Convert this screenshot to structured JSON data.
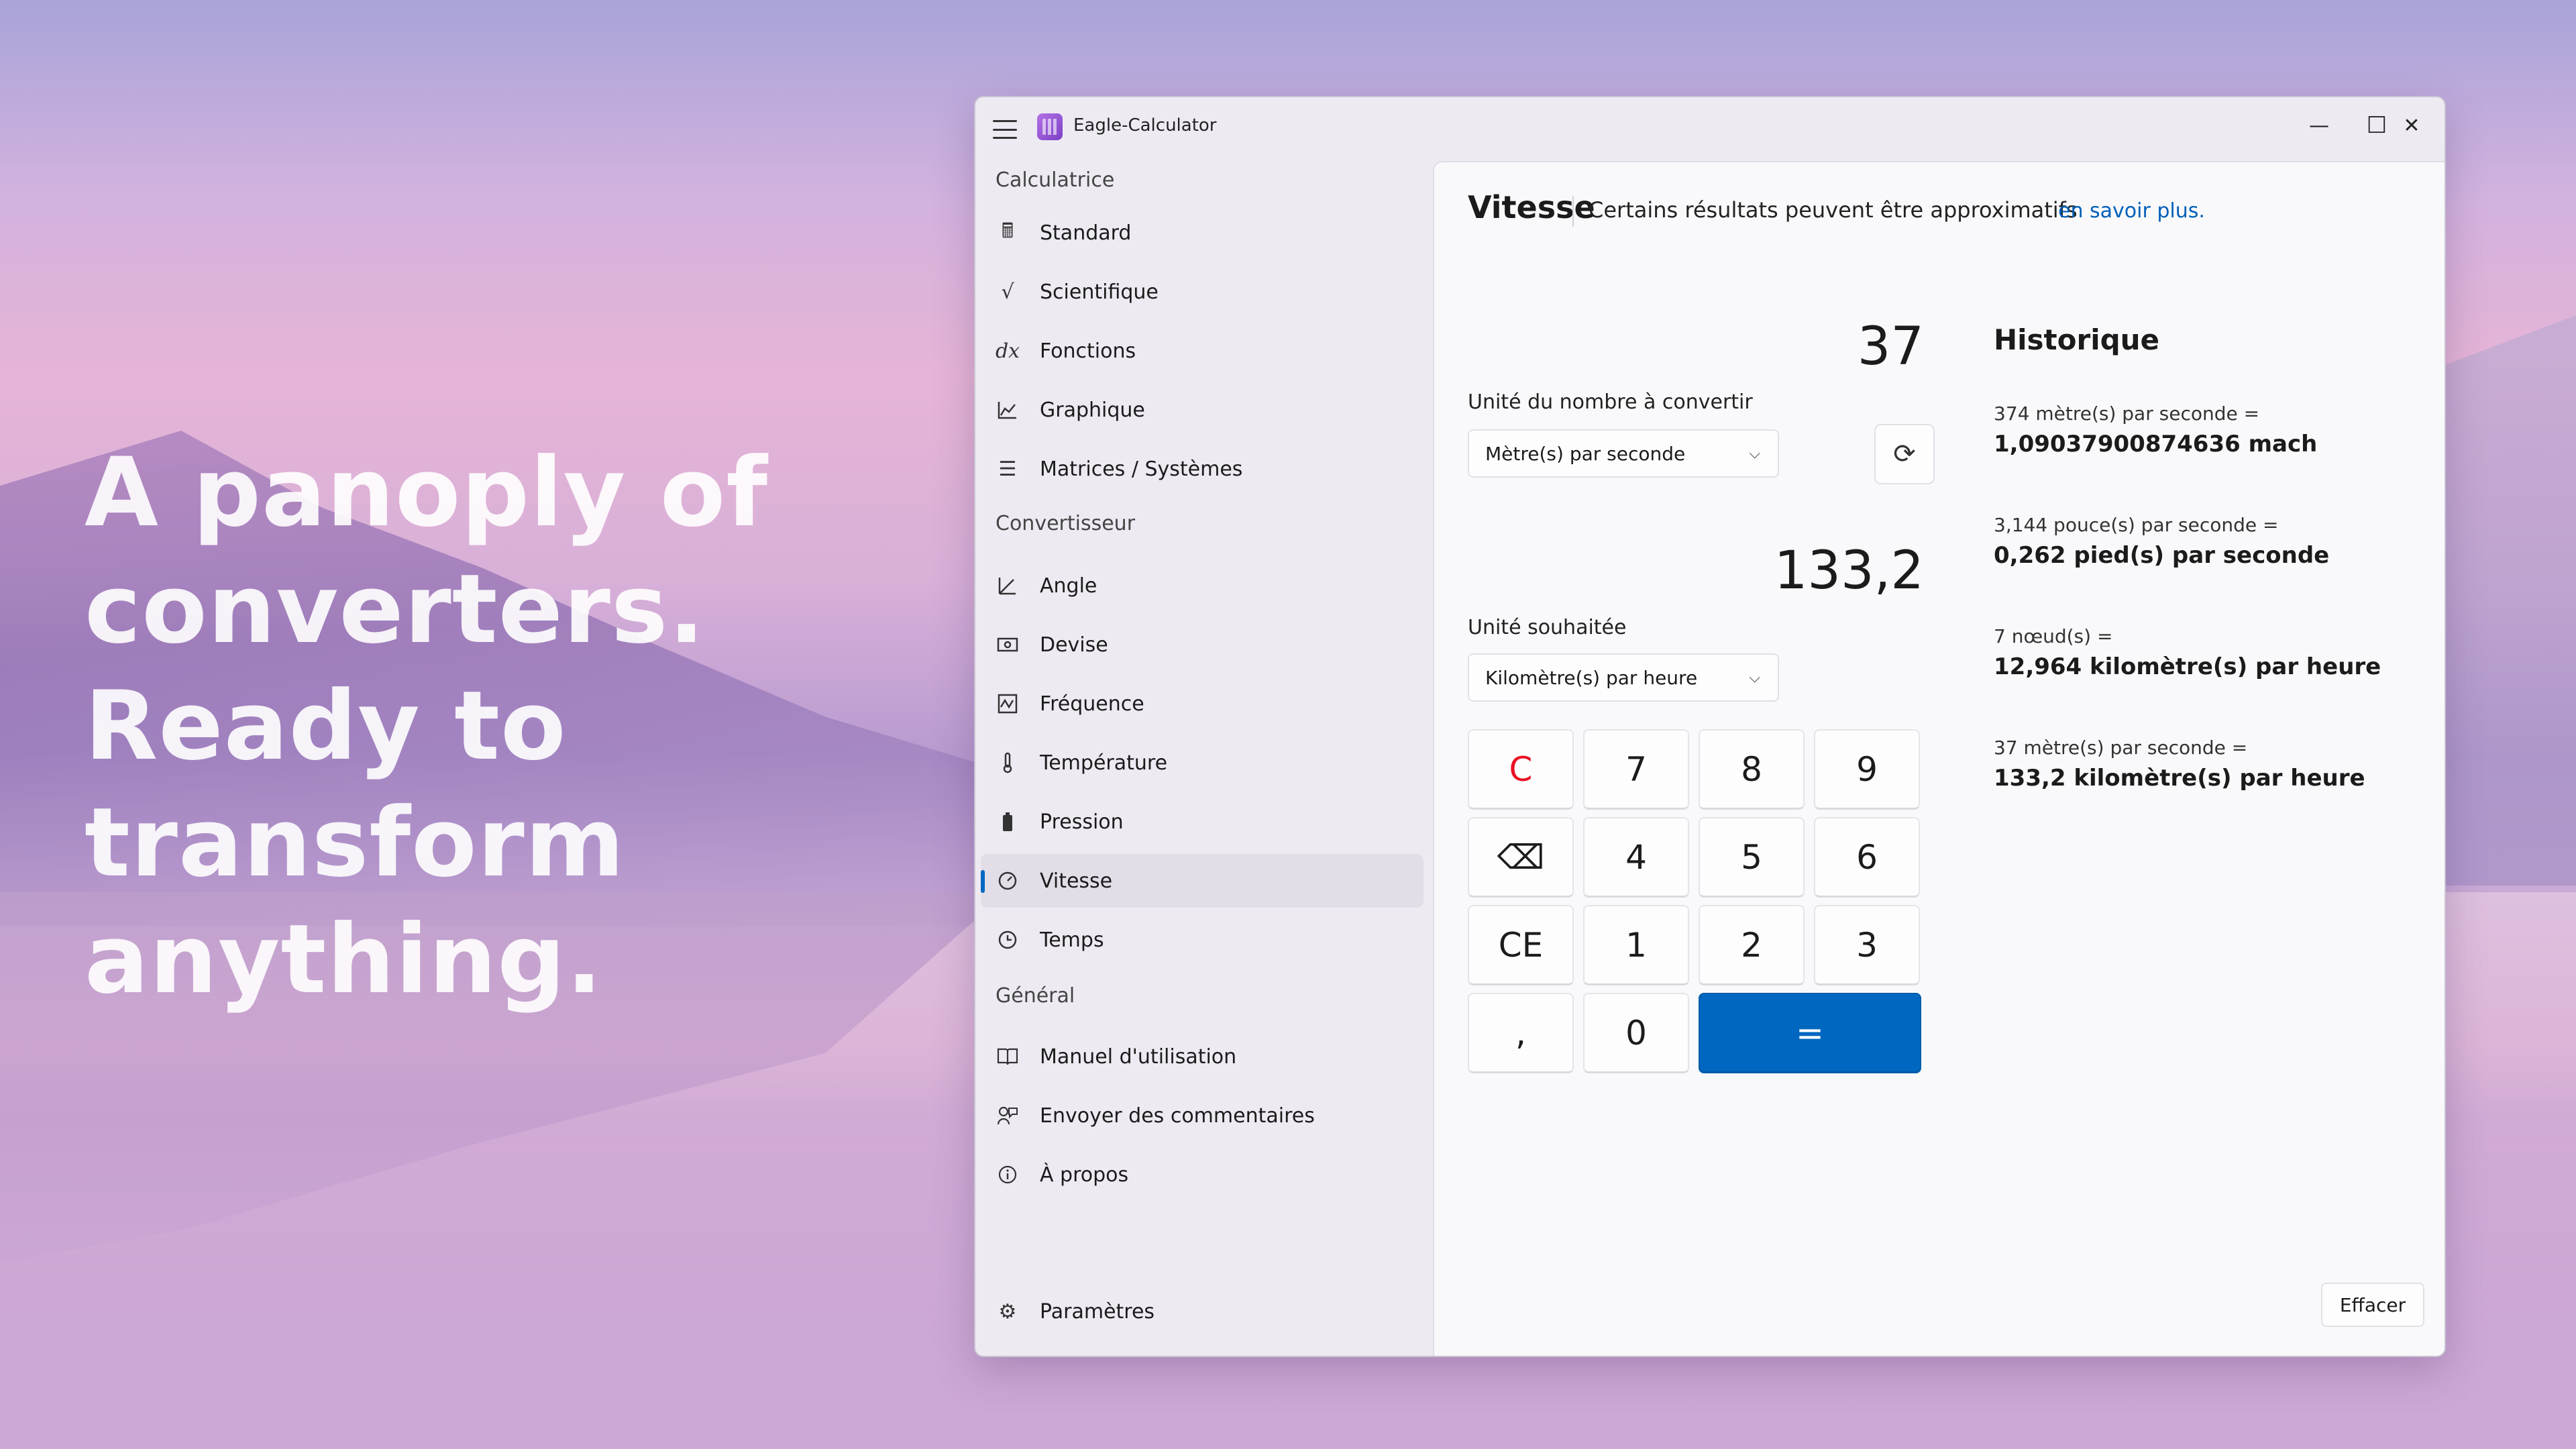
{
  "hero": {
    "text": "A panoply of\nconverters.\nReady to\ntransform\nanything."
  },
  "app": {
    "title": "Eagle-Calculator"
  },
  "window_controls": {
    "minimize": "—",
    "maximize": "☐",
    "close": "✕"
  },
  "sidebar": {
    "section_calculator": "Calculatrice",
    "calculator_items": [
      {
        "label": "Standard",
        "icon": "calculator-icon"
      },
      {
        "label": "Scientifique",
        "icon": "square-root-icon"
      },
      {
        "label": "Fonctions",
        "icon": "derivative-icon"
      },
      {
        "label": "Graphique",
        "icon": "chart-icon"
      },
      {
        "label": "Matrices / Systèmes",
        "icon": "list-icon"
      }
    ],
    "section_converter": "Convertisseur",
    "converter_items": [
      {
        "label": "Angle",
        "icon": "angle-icon"
      },
      {
        "label": "Devise",
        "icon": "currency-icon"
      },
      {
        "label": "Fréquence",
        "icon": "frequency-icon"
      },
      {
        "label": "Température",
        "icon": "thermometer-icon"
      },
      {
        "label": "Pression",
        "icon": "pressure-icon"
      },
      {
        "label": "Vitesse",
        "icon": "speedometer-icon",
        "active": true
      },
      {
        "label": "Temps",
        "icon": "clock-icon"
      }
    ],
    "section_general": "Général",
    "general_items": [
      {
        "label": "Manuel d'utilisation",
        "icon": "book-icon"
      },
      {
        "label": "Envoyer des commentaires",
        "icon": "feedback-icon"
      },
      {
        "label": "À propos",
        "icon": "info-icon"
      }
    ],
    "settings_label": "Paramètres"
  },
  "main": {
    "title": "Vitesse",
    "subtitle": "Certains résultats peuvent être approximatifs",
    "learn_more": "en savoir plus.",
    "input_value": "37",
    "from_label": "Unité du nombre à convertir",
    "from_unit": "Mètre(s) par seconde",
    "output_value": "133,2",
    "to_label": "Unité souhaitée",
    "to_unit": "Kilomètre(s) par heure",
    "keypad": [
      "C",
      "7",
      "8",
      "9",
      "⌫",
      "4",
      "5",
      "6",
      "CE",
      "1",
      "2",
      "3",
      ",",
      "0",
      "="
    ]
  },
  "history": {
    "title": "Historique",
    "entries": [
      {
        "expression": "374 mètre(s) par seconde =",
        "result": "1,09037900874636 mach"
      },
      {
        "expression": "3,144 pouce(s) par seconde =",
        "result": "0,262 pied(s) par seconde"
      },
      {
        "expression": "7 nœud(s) =",
        "result": "12,964 kilomètre(s) par heure"
      },
      {
        "expression": "37 mètre(s) par seconde =",
        "result": "133,2 kilomètre(s) par heure"
      }
    ],
    "clear_label": "Effacer"
  },
  "colors": {
    "accent": "#0067c0",
    "clear_key": "#e81123"
  }
}
